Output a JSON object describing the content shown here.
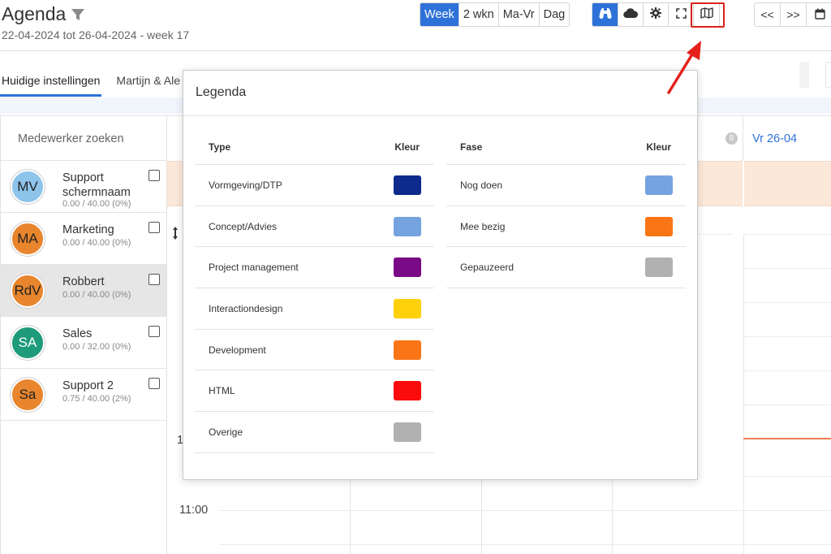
{
  "header": {
    "title": "Agenda",
    "subtitle": "22-04-2024 tot 26-04-2024 - week 17"
  },
  "view_buttons": [
    {
      "label": "Week",
      "active": true
    },
    {
      "label": "2 wkn",
      "active": false
    },
    {
      "label": "Ma-Vr",
      "active": false
    },
    {
      "label": "Dag",
      "active": false
    }
  ],
  "tool_buttons": [
    "binoculars-icon",
    "cloud-icon",
    "gear-icon",
    "fullscreen-icon",
    "map-icon"
  ],
  "nav_buttons": {
    "prev": "<<",
    "next": ">>",
    "calendar": "calendar-icon"
  },
  "tabs": [
    {
      "label": "Huidige instellingen",
      "active": true
    },
    {
      "label": "Martijn & Ale",
      "active": false
    }
  ],
  "employee_panel": {
    "search_placeholder": "Medewerker zoeken",
    "employees": [
      {
        "initials": "MV",
        "name": "Support schermnaam",
        "hours": "0.00 / 40.00 (0%)",
        "avatar_color": "#8dc4ea",
        "selected": false
      },
      {
        "initials": "MA",
        "name": "Marketing",
        "hours": "0.00 / 40.00 (0%)",
        "avatar_color": "#e8852d",
        "selected": false
      },
      {
        "initials": "RdV",
        "name": "Robbert",
        "hours": "0.00 / 40.00 (0%)",
        "avatar_color": "#e8852d",
        "selected": true
      },
      {
        "initials": "SA",
        "name": "Sales",
        "hours": "0.00 / 32.00 (0%)",
        "avatar_color": "#1e9b7a",
        "selected": false
      },
      {
        "initials": "Sa",
        "name": "Support 2",
        "hours": "0.75 / 40.00 (2%)",
        "avatar_color": "#e8852d",
        "selected": false
      }
    ]
  },
  "calendar": {
    "day_label": "Vr 26-04",
    "week_badge": "8",
    "time_label": "11:00",
    "time_fragment": "1"
  },
  "legend": {
    "title": "Legenda",
    "type_header": "Type",
    "type_color_header": "Kleur",
    "types": [
      {
        "label": "Vormgeving/DTP",
        "color": "#0d2a8c"
      },
      {
        "label": "Concept/Advies",
        "color": "#74a3e0"
      },
      {
        "label": "Project management",
        "color": "#7a0a86"
      },
      {
        "label": "Interactiondesign",
        "color": "#fdd10a"
      },
      {
        "label": "Development",
        "color": "#fa7516"
      },
      {
        "label": "HTML",
        "color": "#fb0c0c"
      },
      {
        "label": "Overige",
        "color": "#b1b1b1"
      }
    ],
    "fase_header": "Fase",
    "fase_color_header": "Kleur",
    "fases": [
      {
        "label": "Nog doen",
        "color": "#74a3e0"
      },
      {
        "label": "Mee bezig",
        "color": "#fa7516"
      },
      {
        "label": "Gepauzeerd",
        "color": "#b1b1b1"
      }
    ]
  },
  "colors": {
    "accent": "#2e72d9",
    "highlight_box": "#d9221c",
    "arrow": "#e5201b"
  }
}
